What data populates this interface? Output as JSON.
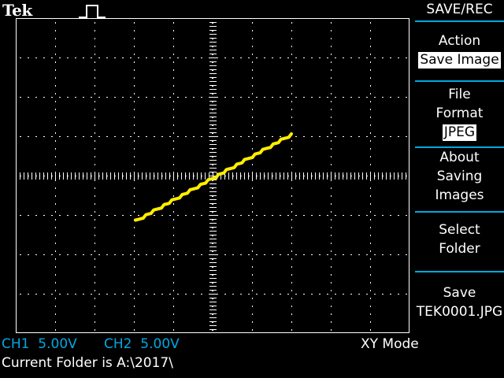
{
  "header": {
    "brand": "Tek",
    "trigger_icon": "pulse-icon"
  },
  "colors": {
    "trace": "#ffee00",
    "grid": "#ffffff",
    "menu_accent": "#00a8e0",
    "channel_text": "#00a8e0",
    "background": "#000000"
  },
  "menu": {
    "title": "SAVE/REC",
    "items": [
      {
        "label_lines": [
          "Action"
        ],
        "value": "Save Image"
      },
      {
        "label_lines": [
          "File",
          "Format"
        ],
        "value": "JPEG"
      },
      {
        "label_lines": [
          "About",
          "Saving",
          "Images"
        ]
      },
      {
        "label_lines": [
          "Select",
          "Folder"
        ]
      },
      {
        "label_lines": [
          "Save",
          "TEK0001.JPG"
        ]
      }
    ]
  },
  "status": {
    "ch1": "CH1  5.00V",
    "ch2": "CH2  5.00V",
    "mode": "XY Mode",
    "folder": "Current Folder is A:\\2017\\"
  }
}
